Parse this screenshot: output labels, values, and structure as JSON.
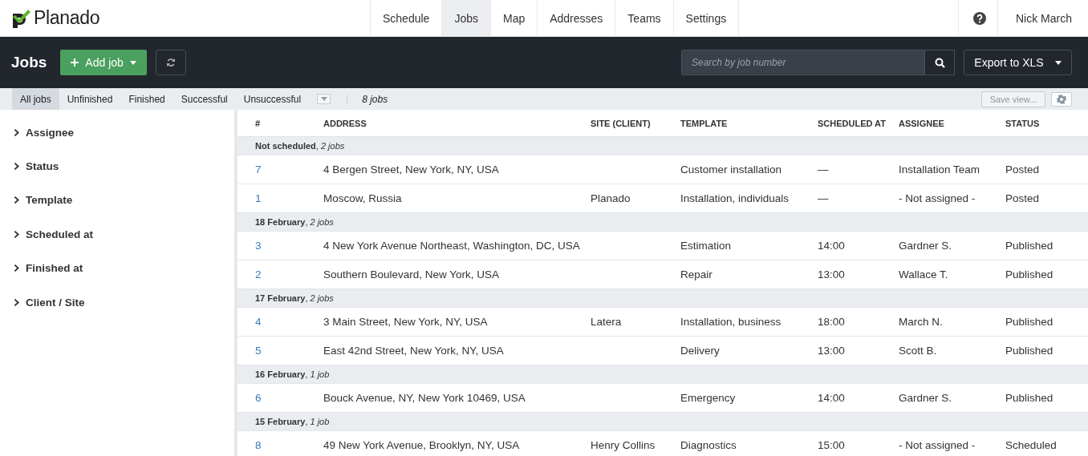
{
  "brand": {
    "name": "Planado"
  },
  "nav": [
    {
      "label": "Schedule",
      "selected": false
    },
    {
      "label": "Jobs",
      "selected": true
    },
    {
      "label": "Map",
      "selected": false
    },
    {
      "label": "Addresses",
      "selected": false
    },
    {
      "label": "Teams",
      "selected": false
    },
    {
      "label": "Settings",
      "selected": false
    }
  ],
  "user": {
    "name": "Nick March"
  },
  "toolbar": {
    "title": "Jobs",
    "add_button": "Add job",
    "search": {
      "placeholder": "Search by job number"
    },
    "export_button": "Export to XLS"
  },
  "filters": [
    {
      "label": "All jobs",
      "selected": true
    },
    {
      "label": "Unfinished",
      "selected": false
    },
    {
      "label": "Finished",
      "selected": false
    },
    {
      "label": "Successful",
      "selected": false
    },
    {
      "label": "Unsuccessful",
      "selected": false
    }
  ],
  "job_count": "8 jobs",
  "save_view": {
    "label": "Save view...",
    "disabled": true
  },
  "sidebar": {
    "items": [
      {
        "label": "Assignee",
        "expanded": false
      },
      {
        "label": "Status",
        "expanded": false
      },
      {
        "label": "Template",
        "expanded": false
      },
      {
        "label": "Scheduled at",
        "expanded": false
      },
      {
        "label": "Finished at",
        "expanded": false
      },
      {
        "label": "Client / Site",
        "expanded": false
      }
    ]
  },
  "table": {
    "columns": [
      "#",
      "ADDRESS",
      "SITE (CLIENT)",
      "TEMPLATE",
      "SCHEDULED AT",
      "ASSIGNEE",
      "STATUS"
    ],
    "groups": [
      {
        "label": "**Not scheduled**, *2 jobs*",
        "rows": [
          [
            "7",
            "4 Bergen Street, New York, NY, USA",
            "",
            "Customer installation",
            "—",
            "Installation Team",
            "Posted"
          ],
          [
            "1",
            "Moscow, Russia",
            "Planado",
            "Installation, individuals",
            "—",
            "- Not assigned -",
            "Posted"
          ]
        ]
      },
      {
        "label": "**18 February**, *2 jobs*",
        "rows": [
          [
            "3",
            "4 New York Avenue Northeast, Washington, DC, USA",
            "",
            "Estimation",
            "14:00",
            "Gardner S.",
            "Published"
          ],
          [
            "2",
            "Southern Boulevard, New York, USA",
            "",
            "Repair",
            "13:00",
            "Wallace T.",
            "Published"
          ]
        ]
      },
      {
        "label": "**17 February**, *2 jobs*",
        "rows": [
          [
            "4",
            "3 Main Street, New York, NY, USA",
            "Latera",
            "Installation, business",
            "18:00",
            "March N.",
            "Published"
          ],
          [
            "5",
            "East 42nd Street, New York, NY, USA",
            "",
            "Delivery",
            "13:00",
            "Scott B.",
            "Published"
          ]
        ]
      },
      {
        "label": "**16 February**, *1 job*",
        "rows": [
          [
            "6",
            "Bouck Avenue, NY, New York 10469, USA",
            "",
            "Emergency",
            "14:00",
            "Gardner S.",
            "Published"
          ]
        ]
      },
      {
        "label": "**15 February**, *1 job*",
        "rows": [
          [
            "8",
            "49 New York Avenue, Brooklyn, NY, USA",
            "Henry Collins",
            "Diagnostics",
            "15:00",
            "- Not assigned -",
            "Scheduled"
          ]
        ]
      }
    ]
  }
}
